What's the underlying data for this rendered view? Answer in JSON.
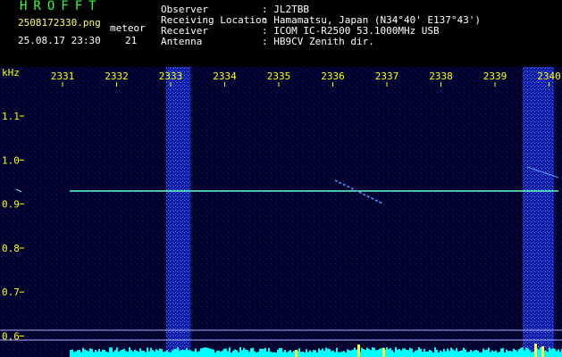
{
  "header": {
    "app_title": "HROFFT",
    "filename": "2508172330.png",
    "datetime": "25.08.17 23:30",
    "meteor_label": "meteor",
    "meteor_count": "21",
    "info": [
      {
        "label": "Observer",
        "value": ": JL2TBB"
      },
      {
        "label": "Receiving Location",
        "value": ": Hamamatsu, Japan (N34°40' E137°43')"
      },
      {
        "label": "Receiver",
        "value": ": ICOM IC-R2500 53.1000MHz USB"
      },
      {
        "label": "Antenna",
        "value": ": HB9CV Zenith dir."
      }
    ]
  },
  "spectrogram": {
    "y_axis_unit": "kHz",
    "y_ticks": [
      "1.1",
      "1.0",
      "0.9",
      "0.8",
      "0.7",
      "0.6"
    ],
    "x_ticks": [
      "2331",
      "2332",
      "2333",
      "2334",
      "2335",
      "2336",
      "2337",
      "2338",
      "2339",
      "2340"
    ],
    "colors": {
      "background": "#00002a",
      "signal": "#66ffcc",
      "noise": "#1a2cff",
      "spectrum": "#00ffff",
      "axis": "#ffff00"
    }
  }
}
